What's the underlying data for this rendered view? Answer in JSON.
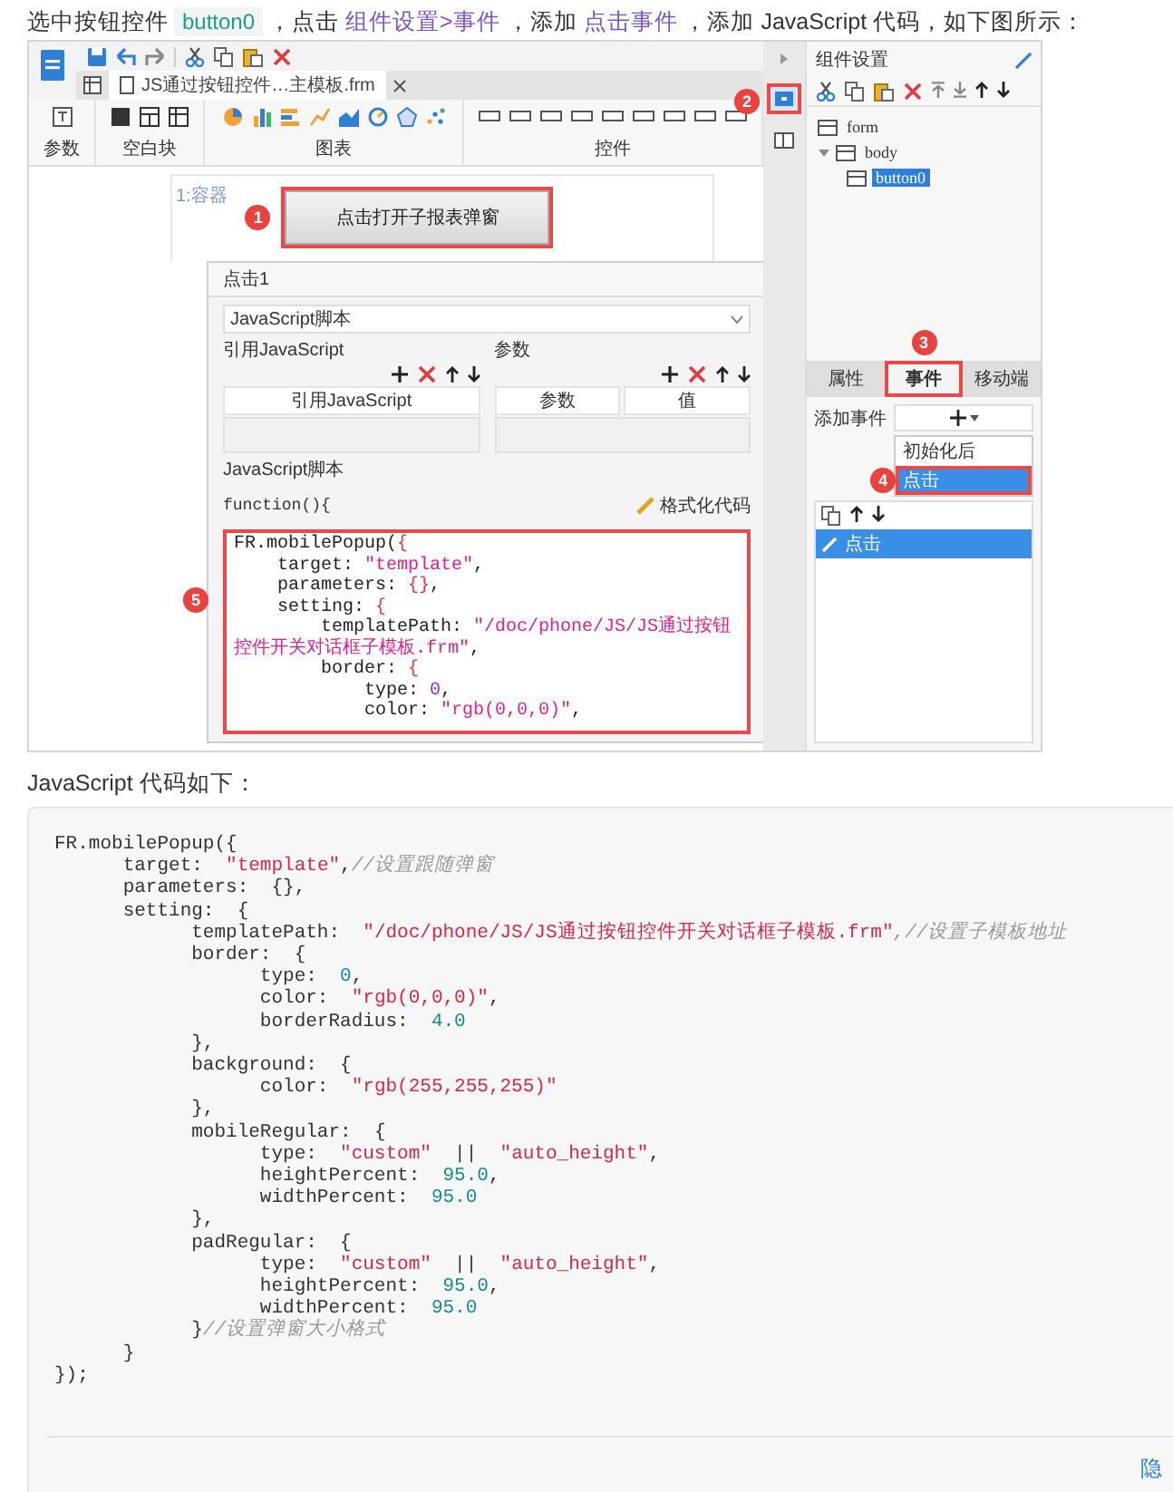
{
  "intro": [
    {
      "kind": "text",
      "text": "选中按钮控件 "
    },
    {
      "kind": "code",
      "text": "button0"
    },
    {
      "kind": "text",
      "text": " ，点击 "
    },
    {
      "kind": "term",
      "text": "组件设置>事件"
    },
    {
      "kind": "text",
      "text": " ，添加 "
    },
    {
      "kind": "term",
      "text": "点击事件"
    },
    {
      "kind": "text",
      "text": " ，添加 JavaScript 代码，如下图所示："
    }
  ],
  "designer": {
    "file_tab": "JS通过按钮控件…主模板.frm",
    "ribbon_groups": [
      {
        "label": "参数",
        "kind": "param"
      },
      {
        "label": "空白块",
        "kind": "blocks"
      },
      {
        "label": "图表",
        "kind": "charts"
      },
      {
        "label": "控件",
        "kind": "widgets"
      }
    ],
    "canvas": {
      "container_label": "1:容器",
      "button": {
        "label": "点击打开子报表弹窗",
        "badge": "1"
      }
    },
    "dialog": {
      "title": "点击1",
      "script_type": "JavaScript脚本",
      "imports": {
        "label": "引用JavaScript",
        "columns": [
          "引用JavaScript"
        ]
      },
      "params": {
        "label": "参数",
        "columns": [
          "参数",
          "值"
        ]
      },
      "script_label": "JavaScript脚本",
      "function_header": "function(){",
      "format_button": "格式化代码",
      "code_badge": "5",
      "code_lines": [
        [
          {
            "kind": "p",
            "text": "FR.mobilePopup("
          },
          {
            "kind": "b",
            "text": "{"
          }
        ],
        [
          {
            "kind": "p",
            "text": "    target: "
          },
          {
            "kind": "s",
            "text": "\"template\""
          },
          {
            "kind": "p",
            "text": ","
          }
        ],
        [
          {
            "kind": "p",
            "text": "    parameters: "
          },
          {
            "kind": "b",
            "text": "{}"
          },
          {
            "kind": "p",
            "text": ","
          }
        ],
        [
          {
            "kind": "p",
            "text": "    setting: "
          },
          {
            "kind": "b",
            "text": "{"
          }
        ],
        [
          {
            "kind": "p",
            "text": "        templatePath: "
          },
          {
            "kind": "s",
            "text": "\"/doc/phone/JS/JS通过按钮控件开关对话框子模板.frm\""
          },
          {
            "kind": "p",
            "text": ","
          }
        ],
        [
          {
            "kind": "p",
            "text": "        border: "
          },
          {
            "kind": "b",
            "text": "{"
          }
        ],
        [
          {
            "kind": "p",
            "text": "            type: "
          },
          {
            "kind": "n",
            "text": "0"
          },
          {
            "kind": "p",
            "text": ","
          }
        ],
        [
          {
            "kind": "p",
            "text": "            color: "
          },
          {
            "kind": "s",
            "text": "\"rgb(0,0,0)\""
          },
          {
            "kind": "p",
            "text": ","
          }
        ]
      ]
    },
    "side_strip": {
      "badge": "2"
    },
    "panel": {
      "title": "组件设置",
      "tree": [
        {
          "label": "form",
          "selected": false
        },
        {
          "label": "body",
          "selected": false,
          "expanded": true,
          "children": [
            {
              "label": "button0",
              "selected": true
            }
          ]
        }
      ],
      "tabs": [
        {
          "label": "属性",
          "selected": false
        },
        {
          "label": "事件",
          "selected": true,
          "badge": "3"
        },
        {
          "label": "移动端",
          "selected": false
        }
      ],
      "add_event_label": "添加事件",
      "event_menu": [
        {
          "label": "初始化后",
          "selected": false
        },
        {
          "label": "点击",
          "selected": true,
          "badge": "4"
        }
      ],
      "events": [
        {
          "label": "点击",
          "selected": true
        }
      ]
    }
  },
  "caption": "JavaScript 代码如下：",
  "code_lines": [
    [
      {
        "kind": "p",
        "text": "FR.mobilePopup({"
      }
    ],
    [
      {
        "kind": "p",
        "text": "\ttarget:  "
      },
      {
        "kind": "s",
        "text": "\"template\""
      },
      {
        "kind": "p",
        "text": ","
      },
      {
        "kind": "c",
        "text": "//设置跟随弹窗"
      }
    ],
    [
      {
        "kind": "p",
        "text": "\tparameters:  {},"
      }
    ],
    [
      {
        "kind": "p",
        "text": "\tsetting:  {"
      }
    ],
    [
      {
        "kind": "p",
        "text": "\t\ttemplatePath:  "
      },
      {
        "kind": "s",
        "text": "\"/doc/phone/JS/JS通过按钮控件开关对话框子模板.frm\""
      },
      {
        "kind": "c",
        "text": ",//设置子模板地址"
      }
    ],
    [
      {
        "kind": "p",
        "text": "\t\tborder:  {"
      }
    ],
    [
      {
        "kind": "p",
        "text": "\t\t\ttype:  "
      },
      {
        "kind": "n",
        "text": "0"
      },
      {
        "kind": "p",
        "text": ","
      }
    ],
    [
      {
        "kind": "p",
        "text": "\t\t\tcolor:  "
      },
      {
        "kind": "s",
        "text": "\"rgb(0,0,0)\""
      },
      {
        "kind": "p",
        "text": ","
      }
    ],
    [
      {
        "kind": "p",
        "text": "\t\t\tborderRadius:  "
      },
      {
        "kind": "n",
        "text": "4.0"
      }
    ],
    [
      {
        "kind": "p",
        "text": "\t\t},"
      }
    ],
    [
      {
        "kind": "p",
        "text": "\t\tbackground:  {"
      }
    ],
    [
      {
        "kind": "p",
        "text": "\t\t\tcolor:  "
      },
      {
        "kind": "s",
        "text": "\"rgb(255,255,255)\""
      }
    ],
    [
      {
        "kind": "p",
        "text": "\t\t},"
      }
    ],
    [
      {
        "kind": "p",
        "text": "\t\tmobileRegular:  {"
      }
    ],
    [
      {
        "kind": "p",
        "text": "\t\t\ttype:  "
      },
      {
        "kind": "s",
        "text": "\"custom\""
      },
      {
        "kind": "p",
        "text": "  ||  "
      },
      {
        "kind": "s",
        "text": "\"auto_height\""
      },
      {
        "kind": "p",
        "text": ","
      }
    ],
    [
      {
        "kind": "p",
        "text": "\t\t\theightPercent:  "
      },
      {
        "kind": "n",
        "text": "95.0"
      },
      {
        "kind": "p",
        "text": ","
      }
    ],
    [
      {
        "kind": "p",
        "text": "\t\t\twidthPercent:  "
      },
      {
        "kind": "n",
        "text": "95.0"
      }
    ],
    [
      {
        "kind": "p",
        "text": "\t\t},"
      }
    ],
    [
      {
        "kind": "p",
        "text": "\t\tpadRegular:  {"
      }
    ],
    [
      {
        "kind": "p",
        "text": "\t\t\ttype:  "
      },
      {
        "kind": "s",
        "text": "\"custom\""
      },
      {
        "kind": "p",
        "text": "  ||  "
      },
      {
        "kind": "s",
        "text": "\"auto_height\""
      },
      {
        "kind": "p",
        "text": ","
      }
    ],
    [
      {
        "kind": "p",
        "text": "\t\t\theightPercent:  "
      },
      {
        "kind": "n",
        "text": "95.0"
      },
      {
        "kind": "p",
        "text": ","
      }
    ],
    [
      {
        "kind": "p",
        "text": "\t\t\twidthPercent:  "
      },
      {
        "kind": "n",
        "text": "95.0"
      }
    ],
    [
      {
        "kind": "p",
        "text": "\t\t}"
      },
      {
        "kind": "c",
        "text": "//设置弹窗大小格式"
      }
    ],
    [
      {
        "kind": "p",
        "text": "\t}"
      }
    ],
    [
      {
        "kind": "p",
        "text": "});"
      }
    ]
  ],
  "hide_link": "隐"
}
